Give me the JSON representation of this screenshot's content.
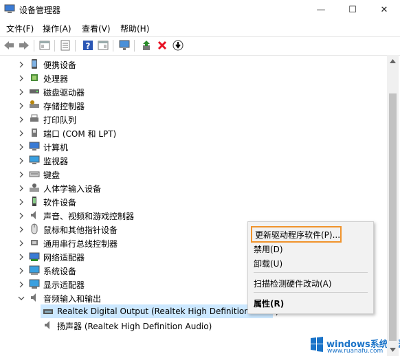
{
  "window": {
    "title": "设备管理器",
    "minimize_glyph": "—",
    "maximize_glyph": "☐",
    "close_glyph": "✕"
  },
  "menubar": [
    {
      "label": "文件(F)"
    },
    {
      "label": "操作(A)"
    },
    {
      "label": "查看(V)"
    },
    {
      "label": "帮助(H)"
    }
  ],
  "toolbar": {
    "icons": [
      "back-arrow-icon",
      "forward-arrow-icon",
      "properties-view-icon",
      "list-view-icon",
      "help-icon",
      "details-view-icon",
      "monitor-scan-icon",
      "update-driver-icon",
      "uninstall-x-icon",
      "download-circle-icon"
    ],
    "colors": {
      "uninstall": "#e81123",
      "help": "#2b57b5",
      "update": "#2a8a2a"
    }
  },
  "tree": {
    "categories": [
      {
        "label": "便携设备",
        "icon": "portable-device-icon"
      },
      {
        "label": "处理器",
        "icon": "processor-icon"
      },
      {
        "label": "磁盘驱动器",
        "icon": "disk-drive-icon"
      },
      {
        "label": "存储控制器",
        "icon": "storage-controller-icon"
      },
      {
        "label": "打印队列",
        "icon": "printer-icon"
      },
      {
        "label": "端口 (COM 和 LPT)",
        "icon": "port-icon"
      },
      {
        "label": "计算机",
        "icon": "computer-icon"
      },
      {
        "label": "监视器",
        "icon": "monitor-icon"
      },
      {
        "label": "键盘",
        "icon": "keyboard-icon"
      },
      {
        "label": "人体学输入设备",
        "icon": "hid-icon"
      },
      {
        "label": "软件设备",
        "icon": "software-device-icon"
      },
      {
        "label": "声音、视频和游戏控制器",
        "icon": "speaker-icon"
      },
      {
        "label": "鼠标和其他指针设备",
        "icon": "mouse-icon"
      },
      {
        "label": "通用串行总线控制器",
        "icon": "usb-icon"
      },
      {
        "label": "网络适配器",
        "icon": "network-adapter-icon"
      },
      {
        "label": "系统设备",
        "icon": "system-device-icon"
      },
      {
        "label": "显示适配器",
        "icon": "display-adapter-icon"
      },
      {
        "label": "音频输入和输出",
        "icon": "audio-io-icon",
        "expanded": true
      }
    ],
    "children": [
      {
        "label": "Realtek Digital Output (Realtek High Definition Audio)",
        "icon": "digital-output-icon",
        "selected": true
      },
      {
        "label": "扬声器 (Realtek High Definition Audio)",
        "icon": "speaker-icon"
      }
    ],
    "selection_color": "#cce8ff"
  },
  "context_menu": {
    "items": [
      {
        "label": "更新驱动程序软件(P)...",
        "highlighted": true
      },
      {
        "label": "禁用(D)"
      },
      {
        "label": "卸载(U)"
      },
      {
        "label": "扫描检测硬件改动(A)"
      },
      {
        "label": "属性(R)",
        "bold": true
      }
    ],
    "highlight_color": "#f0932b"
  },
  "watermark": {
    "text": "windows系统家园",
    "sub": "www.ruanafu.com"
  }
}
